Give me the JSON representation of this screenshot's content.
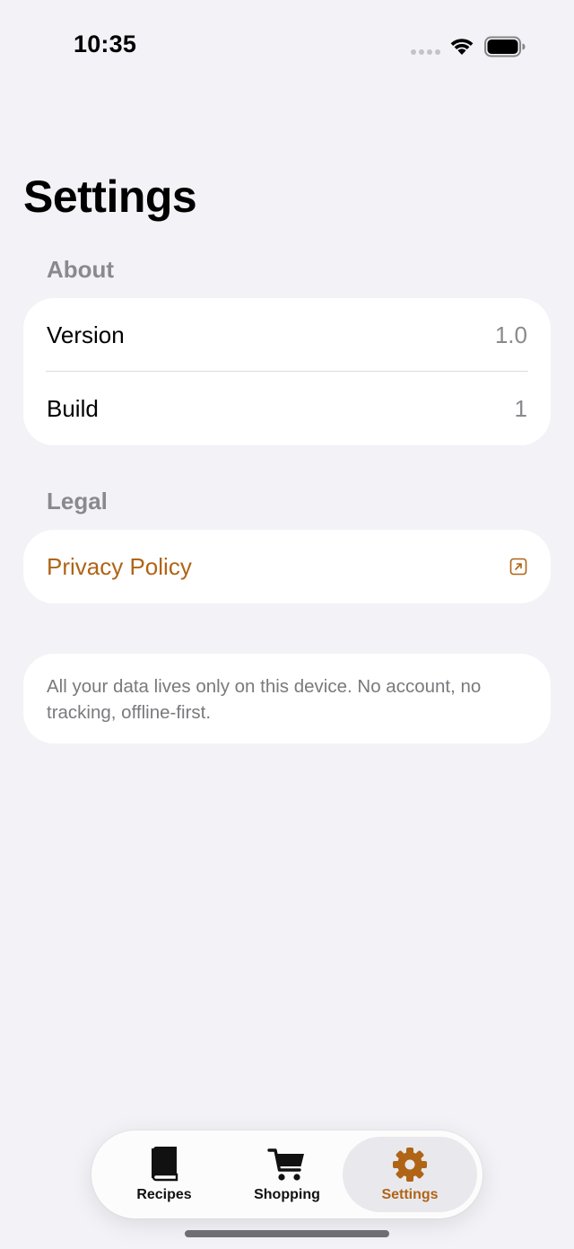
{
  "status_bar": {
    "time": "10:35"
  },
  "page": {
    "title": "Settings"
  },
  "sections": {
    "about": {
      "header": "About",
      "rows": [
        {
          "label": "Version",
          "value": "1.0"
        },
        {
          "label": "Build",
          "value": "1"
        }
      ]
    },
    "legal": {
      "header": "Legal",
      "privacy_label": "Privacy Policy",
      "privacy_icon": "external-link-icon"
    },
    "footer": {
      "note": "All your data lives only on this device. No account, no tracking, offline-first."
    }
  },
  "tab_bar": {
    "tabs": [
      {
        "label": "Recipes",
        "icon": "book-icon",
        "selected": false
      },
      {
        "label": "Shopping",
        "icon": "cart-icon",
        "selected": false
      },
      {
        "label": "Settings",
        "icon": "gear-icon",
        "selected": true
      }
    ]
  },
  "colors": {
    "accent": "#b06416",
    "background": "#f2f2f7",
    "secondary_text": "#8a8a8e"
  }
}
